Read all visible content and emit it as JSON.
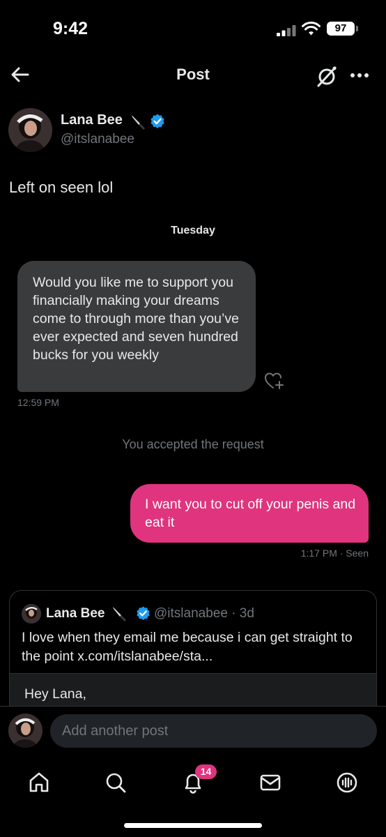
{
  "status_bar": {
    "time": "9:42",
    "battery": "97"
  },
  "header": {
    "title": "Post"
  },
  "post": {
    "author_name": "Lana Bee",
    "author_handle": "@itslanabee",
    "text": "Left on seen lol"
  },
  "dm": {
    "day_label": "Tuesday",
    "incoming_message": "Would you like me to support you financially making your dreams come to through more than you’ve ever expected and seven hundred bucks for you weekly",
    "incoming_time": "12:59 PM",
    "system_message": "You accepted the request",
    "outgoing_message": "I want you to cut off your penis and eat it",
    "outgoing_status": "1:17 PM · Seen"
  },
  "quote": {
    "author_name": "Lana Bee",
    "meta": "@itslanabee · 3d",
    "text": "I love when they email me because i can get straight to the point x.com/itslanabee/sta...",
    "media_text": "Hey Lana,"
  },
  "reply": {
    "placeholder": "Add another post"
  },
  "tabs": {
    "notification_count": "14"
  },
  "colors": {
    "accent_pink": "#e0347e",
    "verified_blue": "#1d9bf0",
    "background": "#000000"
  }
}
